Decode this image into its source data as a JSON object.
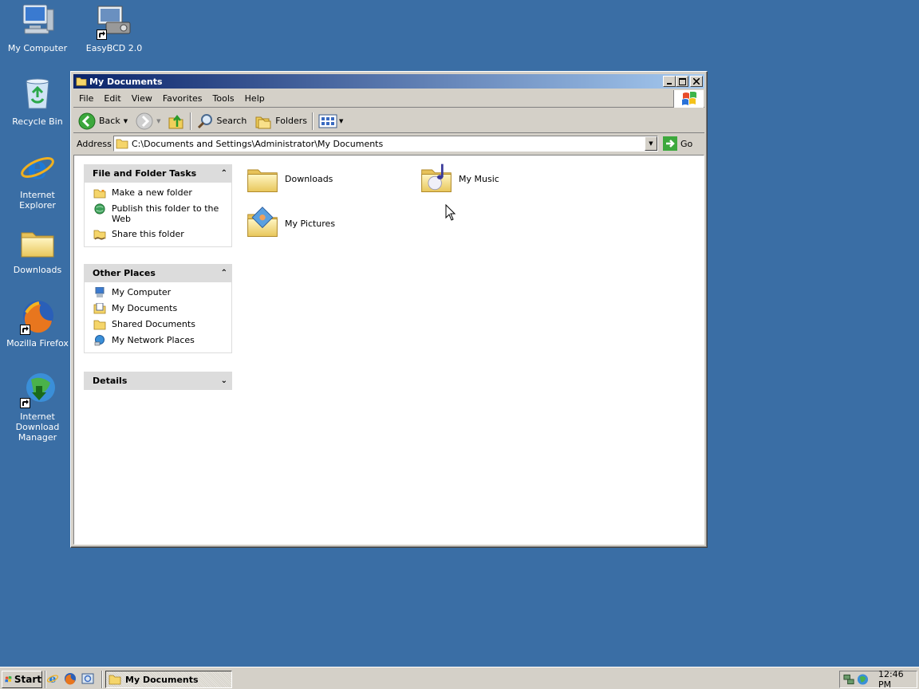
{
  "desktop": {
    "icons": [
      {
        "label": "My Computer",
        "icon": "my-computer-icon"
      },
      {
        "label": "EasyBCD 2.0",
        "icon": "easybcd-icon"
      },
      {
        "label": "Recycle Bin",
        "icon": "recycle-bin-icon"
      },
      {
        "label": "Internet Explorer",
        "icon": "internet-explorer-icon"
      },
      {
        "label": "Downloads",
        "icon": "folder-icon"
      },
      {
        "label": "Mozilla Firefox",
        "icon": "firefox-icon"
      },
      {
        "label": "Internet Download Manager",
        "icon": "idm-icon"
      }
    ]
  },
  "window": {
    "title": "My Documents",
    "menu": [
      "File",
      "Edit",
      "View",
      "Favorites",
      "Tools",
      "Help"
    ],
    "toolbar": {
      "back_label": "Back",
      "search_label": "Search",
      "folders_label": "Folders"
    },
    "address": {
      "label": "Address",
      "path": "C:\\Documents and Settings\\Administrator\\My Documents",
      "go_label": "Go"
    },
    "tasks_panel": {
      "file_folder_tasks": {
        "title": "File and Folder Tasks",
        "items": [
          "Make a new folder",
          "Publish this folder to the Web",
          "Share this folder"
        ]
      },
      "other_places": {
        "title": "Other Places",
        "items": [
          "My Computer",
          "My Documents",
          "Shared Documents",
          "My Network Places"
        ]
      },
      "details": {
        "title": "Details"
      }
    },
    "items": [
      {
        "name": "Downloads",
        "icon": "folder-icon"
      },
      {
        "name": "My Music",
        "icon": "my-music-folder-icon"
      },
      {
        "name": "My Pictures",
        "icon": "my-pictures-folder-icon"
      }
    ]
  },
  "taskbar": {
    "start_label": "Start",
    "task_label": "My Documents",
    "clock": "12:46 PM"
  },
  "colors": {
    "desktop": "#3a6ea5",
    "title_active_start": "#0a246a",
    "title_active_end": "#a6caf0",
    "face": "#d4d0c8"
  }
}
